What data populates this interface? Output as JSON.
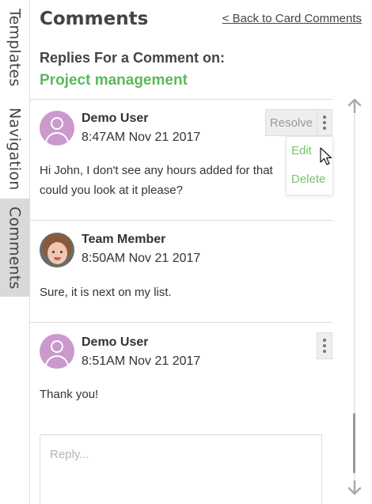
{
  "side_tabs": [
    {
      "label": "Templates",
      "active": false
    },
    {
      "label": "Navigation",
      "active": false
    },
    {
      "label": "Comments",
      "active": true
    }
  ],
  "header": {
    "title": "Comments",
    "back_link": "< Back to Card Comments",
    "replies_heading": "Replies For a Comment on:",
    "card_name": "Project management"
  },
  "comments": [
    {
      "author": "Demo User",
      "timestamp": "8:47AM Nov 21 2017",
      "text_lines": [
        "Hi John, I don't see any hours added for that",
        "could you look at it please?"
      ],
      "avatar": "generic-user-avatar",
      "resolve_label": "Resolve",
      "menu_open": true
    },
    {
      "author": "Team Member",
      "timestamp": "8:50AM Nov 21 2017",
      "text_lines": [
        "Sure, it is next on my list."
      ],
      "avatar": "photo-avatar"
    },
    {
      "author": "Demo User",
      "timestamp": "8:51AM Nov 21 2017",
      "text_lines": [
        "Thank you!"
      ],
      "avatar": "generic-user-avatar"
    }
  ],
  "menu": {
    "edit_label": "Edit",
    "delete_label": "Delete"
  },
  "reply": {
    "placeholder": "Reply..."
  },
  "colors": {
    "accent_green": "#5cb85c",
    "menu_green": "#7cc36a",
    "avatar_purple": "#cc99cc",
    "active_tab_bg": "#d9d9d9"
  },
  "icons": [
    "more-vertical-icon",
    "mouse-pointer-icon",
    "scroll-up-arrow-icon",
    "scroll-down-arrow-icon"
  ]
}
